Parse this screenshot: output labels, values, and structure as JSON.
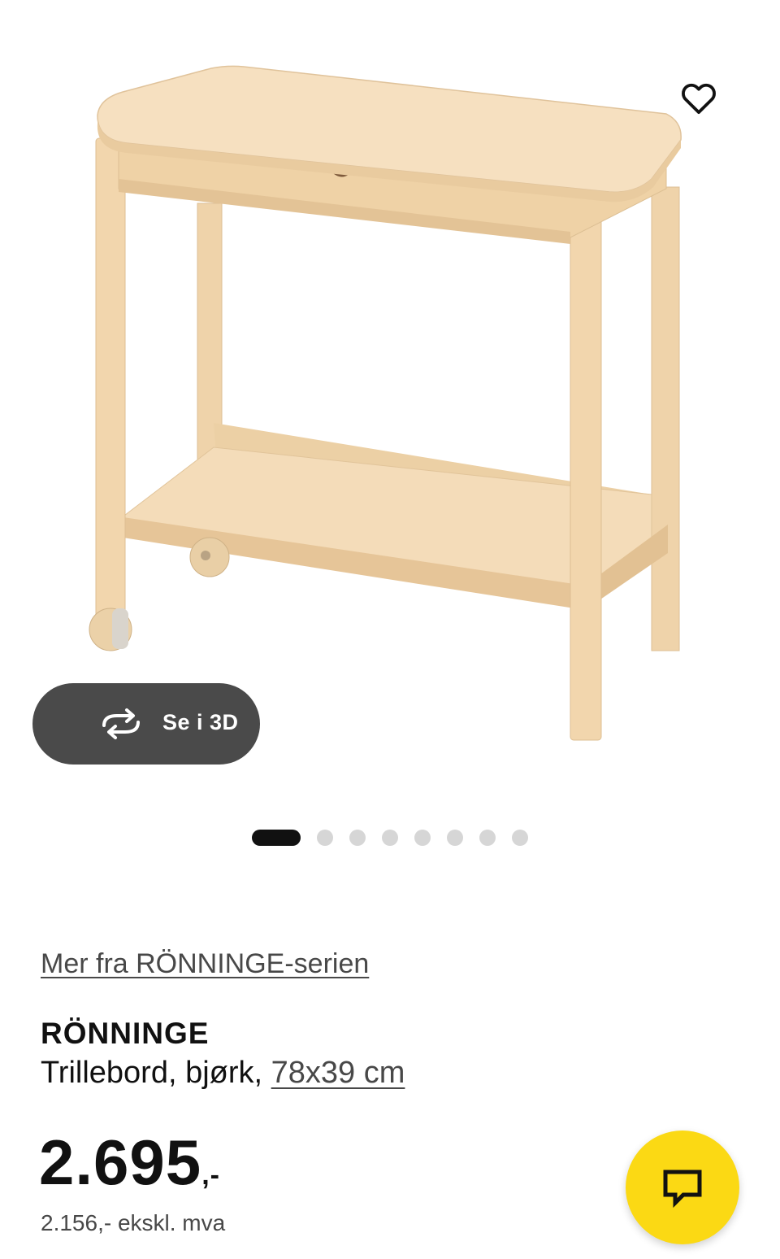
{
  "gallery": {
    "image_alt": "RÖNNINGE Trillebord, bjørk",
    "favorite_icon": "heart-outline-icon",
    "view3d": {
      "label": "Se i 3D",
      "icon": "rotate-3d-icon"
    },
    "slide_count": 8,
    "active_slide": 1
  },
  "product": {
    "series_link": "Mer fra RÖNNINGE-serien",
    "name": "RÖNNINGE",
    "description": "Trillebord, bjørk, ",
    "size_link": "78x39 cm",
    "price_main": "2.695",
    "price_suffix": ",-",
    "price_ex_vat": "2.156,- ekskl. mva"
  },
  "chat": {
    "icon": "chat-bubble-icon"
  },
  "colors": {
    "chat_button": "#fbd914",
    "view3d_button": "#4a4a4a",
    "wood_light": "#f3dcb8",
    "wood_mid": "#e8c99d"
  }
}
